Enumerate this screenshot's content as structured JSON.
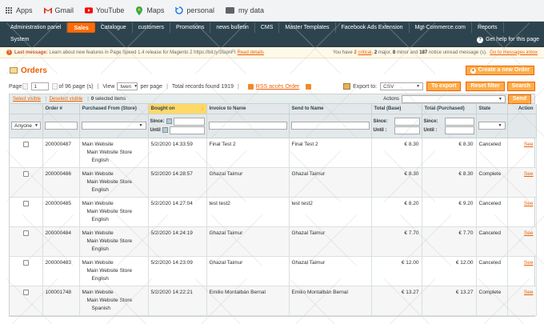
{
  "bookmarks": [
    {
      "label": "Apps",
      "icon": "apps-grid-icon"
    },
    {
      "label": "Gmail",
      "icon": "gmail-icon"
    },
    {
      "label": "YouTube",
      "icon": "youtube-icon"
    },
    {
      "label": "Maps",
      "icon": "maps-icon"
    },
    {
      "label": "personal",
      "icon": "sync-icon"
    },
    {
      "label": "my data",
      "icon": "folder-icon"
    }
  ],
  "nav": {
    "items": [
      "Administration panel",
      "Sales",
      "Catalogue",
      "customers",
      "Promotions",
      "news bulletin",
      "CMS",
      "Master Templates",
      "Facebook Ads Extension",
      "Mgt-Commerce.com",
      "Reports"
    ],
    "row2": [
      "System"
    ],
    "active": "Sales",
    "help": "Get help for this page"
  },
  "message": {
    "label": "Last message:",
    "text": "Learn about new features in Page Speed 1.4 release for Magento 2 https://bit.ly/3fapnFt",
    "read_details": "Read details",
    "right_prefix": "You have",
    "critical_count": "2",
    "critical": "critical",
    "major_count": "2",
    "major": "major,",
    "minor_count": "8",
    "minor": "minor and",
    "notice_count": "187",
    "notice": "notice unread message (s).",
    "goto": "Go to messages inbox"
  },
  "page": {
    "title": "Orders",
    "create_button": "Create a new Order"
  },
  "pager": {
    "page_label": "Page",
    "page_value": "1",
    "of_pages": "of 96 page (s)",
    "view_label": "View",
    "view_value": "twen",
    "per_page": "per page",
    "total": "Total records found 1919",
    "rss": "RSS accès Order",
    "export_to": "Export to:",
    "export_value": "CSV",
    "export_button": "To export",
    "reset_button": "Reset filter",
    "search_button": "Search"
  },
  "mass": {
    "select_visible": "Select visible",
    "deselect_visible": "Deselect visible",
    "selected_count": "0",
    "selected_label": "selected items",
    "actions_label": "Actions",
    "send_button": "Send"
  },
  "columns": {
    "order": "Order #",
    "purchased_from": "Purchased From (Store)",
    "bought_on": "Bought on",
    "invoice_to": "Invoice to Name",
    "send_to": "Send to Name",
    "total_base": "Total (Base)",
    "total_purchased": "Total (Purchased)",
    "state": "State",
    "action": "Action"
  },
  "filters": {
    "anyone": "Anyone",
    "since": "Since:",
    "until": "Until",
    "until_colon": "Until :"
  },
  "rows": [
    {
      "order": "200000487",
      "store": [
        "Main Website",
        "Main Website Store",
        "English"
      ],
      "date": "5/2/2020 14:33:59",
      "invoice": "Final Test 2",
      "send": "Final Test 2",
      "base": "€ 8.30",
      "purchased": "€ 8.30",
      "state": "Canceled",
      "action": "See"
    },
    {
      "order": "200000486",
      "store": [
        "Main Website",
        "Main Website Store",
        "English"
      ],
      "date": "5/2/2020 14:28:57",
      "invoice": "Ghazal Taimur",
      "send": "Ghazal Taimur",
      "base": "€ 8.30",
      "purchased": "€ 8.30",
      "state": "Complete",
      "action": "See"
    },
    {
      "order": "200000485",
      "store": [
        "Main Website",
        "Main Website Store",
        "English"
      ],
      "date": "5/2/2020 14:27:04",
      "invoice": "test test2",
      "send": "test test2",
      "base": "€ 8.20",
      "purchased": "€ 9.20",
      "state": "Canceled",
      "action": "See"
    },
    {
      "order": "200000484",
      "store": [
        "Main Website",
        "Main Website Store",
        "English"
      ],
      "date": "5/2/2020 14:24:19",
      "invoice": "Ghazal Taimur",
      "send": "Ghazal Taimur",
      "base": "€ 7.70",
      "purchased": "€ 7.70",
      "state": "Canceled",
      "action": "See"
    },
    {
      "order": "200000483",
      "store": [
        "Main Website",
        "Main Website Store",
        "English"
      ],
      "date": "5/2/2020 14:23:09",
      "invoice": "Ghazal Taimur",
      "send": "Ghazal Taimur",
      "base": "€ 12.00",
      "purchased": "€ 12.00",
      "state": "Canceled",
      "action": "See"
    },
    {
      "order": "100001748",
      "store": [
        "Main Website",
        "Main Website Store",
        "Spanish"
      ],
      "date": "5/2/2020 14:22:21",
      "invoice": "Emilio Montalbán Bernal",
      "send": "Emilio Montalbán Bernal",
      "base": "€ 13.27",
      "purchased": "€ 13.27",
      "state": "Complete",
      "action": "See"
    }
  ],
  "colors": {
    "nav_bg": "#2d444f",
    "accent": "#eb5e00",
    "button": "#ffac47",
    "sorted_header": "#ffd967"
  }
}
